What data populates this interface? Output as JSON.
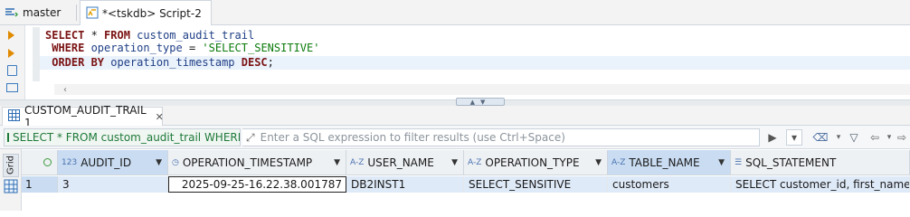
{
  "tabs": {
    "branch": "master",
    "script_tab": "*<tskdb> Script-2"
  },
  "editor": {
    "lines": [
      [
        {
          "t": "SELECT",
          "c": "kw"
        },
        {
          "t": " * ",
          "c": "op"
        },
        {
          "t": "FROM",
          "c": "kw"
        },
        {
          "t": " custom_audit_trail",
          "c": "id"
        }
      ],
      [
        {
          "t": " WHERE",
          "c": "kw"
        },
        {
          "t": " operation_type",
          "c": "id"
        },
        {
          "t": " = ",
          "c": "op"
        },
        {
          "t": "'SELECT_SENSITIVE'",
          "c": "str"
        }
      ],
      [
        {
          "t": " ORDER BY",
          "c": "kw"
        },
        {
          "t": " operation_timestamp ",
          "c": "id"
        },
        {
          "t": "DESC",
          "c": "kw"
        },
        {
          "t": ";",
          "c": "op"
        }
      ]
    ]
  },
  "results": {
    "tab_label": "CUSTOM_AUDIT_TRAIL 1",
    "filter_query": "SELECT * FROM custom_audit_trail WHERE op",
    "filter_placeholder": "Enter a SQL expression to filter results (use Ctrl+Space)",
    "side_label": "Grid",
    "columns": [
      {
        "type": "123",
        "name": "AUDIT_ID",
        "selected": true
      },
      {
        "type": "clock",
        "name": "OPERATION_TIMESTAMP",
        "selected": false
      },
      {
        "type": "A-Z",
        "name": "USER_NAME",
        "selected": false
      },
      {
        "type": "A-Z",
        "name": "OPERATION_TYPE",
        "selected": false
      },
      {
        "type": "A-Z",
        "name": "TABLE_NAME",
        "selected": true
      },
      {
        "type": "doc",
        "name": "SQL_STATEMENT",
        "selected": false
      }
    ],
    "rows": [
      {
        "num": "1",
        "cells": [
          "3",
          "2025-09-25-16.22.38.001787",
          "DB2INST1",
          "SELECT_SENSITIVE",
          "customers",
          "SELECT customer_id, first_name, last_"
        ]
      }
    ]
  },
  "colors": {
    "keyword": "#7a1212",
    "identifier": "#1f3f86",
    "string": "#0b7a0b",
    "selected_header": "#c9dcf2",
    "filter_text": "#1f7a3a"
  }
}
